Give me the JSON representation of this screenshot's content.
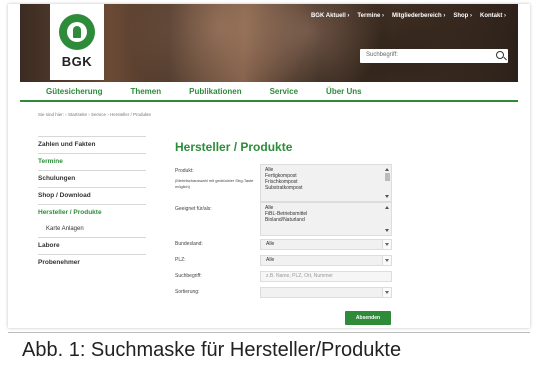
{
  "brand": {
    "logo_text": "BGK",
    "accent": "#2e8b3a"
  },
  "topnav": [
    "BGK Aktuell ›",
    "Termine ›",
    "Mitgliederbereich ›",
    "Shop ›",
    "Kontakt ›"
  ],
  "search": {
    "placeholder": "Suchbegriff:"
  },
  "mainnav": [
    "Gütesicherung",
    "Themen",
    "Publikationen",
    "Service",
    "Über Uns"
  ],
  "breadcrumb": "Sie sind hier: › Startseite › Service › Hersteller / Produkte",
  "sidebar": {
    "items": [
      "Zahlen und Fakten",
      "Termine",
      "Schulungen",
      "Shop / Download",
      "Hersteller / Produkte",
      "Karte Anlagen",
      "Labore",
      "Probenehmer"
    ]
  },
  "content": {
    "title": "Hersteller / Produkte",
    "produkt_label": "Produkt:",
    "produkt_note": "(Mehrfachauswahl mit gedrückter Strg-Taste möglich)",
    "produkt_options": [
      "Alle",
      "Fertigkompost",
      "Frischkompost",
      "Substratkompost"
    ],
    "geeignet_label": "Geeignet für/als:",
    "geeignet_options": [
      "Alle",
      "FiBL-Betriebsmittel",
      "Bioland/Naturland"
    ],
    "bundesland_label": "Bundesland:",
    "bundesland_value": "Alle",
    "plz_label": "PLZ:",
    "plz_value": "Alle",
    "suchbegriff_label": "Suchbegriff:",
    "suchbegriff_placeholder": "z.B. Name, PLZ, Ort, Nummer",
    "sortierung_label": "Sortierung:",
    "sortierung_value": "",
    "submit_label": "Absenden"
  },
  "caption": "Abb. 1: Suchmaske für Hersteller/Produkte"
}
